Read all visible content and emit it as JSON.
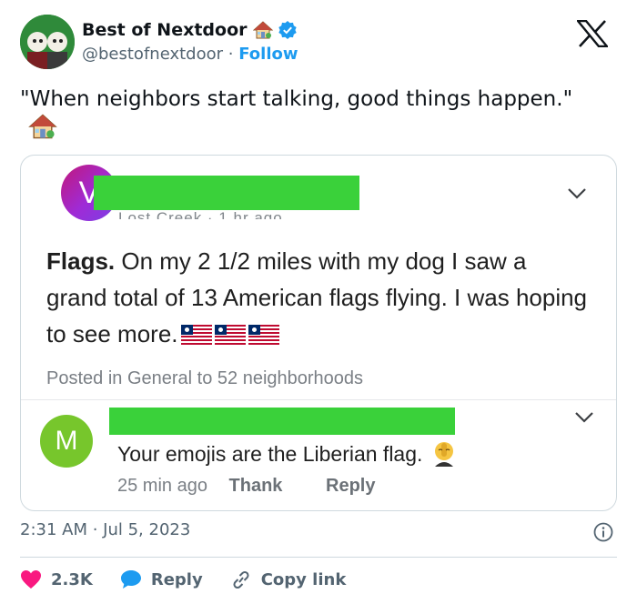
{
  "tweet": {
    "author": {
      "name": "Best of Nextdoor",
      "handle": "@bestofnextdoor",
      "separator": "·",
      "follow_label": "Follow"
    },
    "text": "\"When neighbors start talking, good things happen.\"",
    "timestamp": "2:31 AM · Jul 5, 2023",
    "actions": {
      "likes_count": "2.3K",
      "reply_label": "Reply",
      "copy_link_label": "Copy link"
    },
    "colors": {
      "like": "#f91880",
      "link": "#1d9bf0",
      "verified": "#1d9bf0"
    },
    "icons": [
      "house-emoji-icon",
      "verified-badge-icon",
      "x-logo-icon",
      "info-icon",
      "heart-icon",
      "reply-bubble-icon",
      "link-icon"
    ]
  },
  "embedded": {
    "post": {
      "avatar_letter": "V",
      "meta_partial": "Lost Creek · 1 hr ago",
      "title": "Flags.",
      "body": " On my 2 1/2 miles with my dog I saw a grand total of 13 American flags flying. I was hoping to see more.",
      "footer": "Posted in General to 52 neighborhoods"
    },
    "reply": {
      "avatar_letter": "M",
      "text": "Your emojis are the Liberian flag.",
      "time": "25 min ago",
      "thank_label": "Thank",
      "reply_label": "Reply"
    },
    "colors": {
      "redaction": "#3ad13a"
    }
  }
}
